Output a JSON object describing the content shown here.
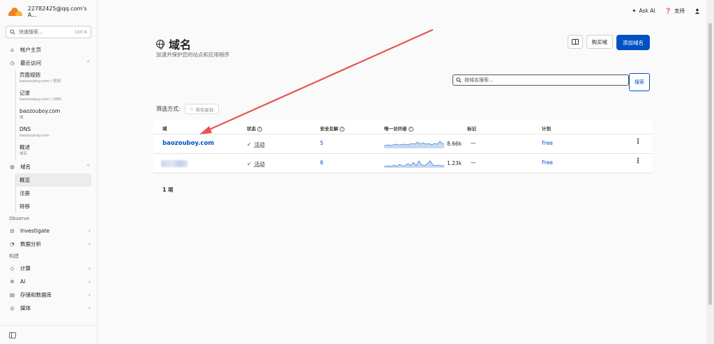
{
  "account": "22782425@qq.com's A...",
  "sidebar": {
    "search_placeholder": "快速搜索...",
    "search_shortcut": "Ctrl K",
    "home": "帐户主页",
    "recent": "最近访问",
    "recent_items": [
      {
        "title": "页面规则",
        "sub": "baozouboy.com / 规则"
      },
      {
        "title": "记录",
        "sub": "baozouboy.com / DNS"
      },
      {
        "title": "baozouboy.com",
        "sub": "域"
      },
      {
        "title": "DNS",
        "sub": "baozouboy.com"
      },
      {
        "title": "概述",
        "sub": "域名"
      }
    ],
    "domains": "域名",
    "domain_items": [
      "概览",
      "注册",
      "转移"
    ],
    "observe_head": "Observe",
    "investigate": "Investigate",
    "analytics": "数据分析",
    "build_head": "构建",
    "compute": "计算",
    "ai": "AI",
    "storage": "存储和数据库",
    "media": "媒体"
  },
  "topbar": {
    "ask_ai": "Ask AI",
    "support": "支持"
  },
  "page": {
    "title": "域名",
    "subtitle": "加速并保护您的站点和应用程序",
    "buy_domain": "购买域",
    "add_domain": "添加域名",
    "search_placeholder": "按域名搜索...",
    "search_button": "搜索",
    "filter_label": "筛选方式:",
    "starred_chip": "带有星标"
  },
  "table": {
    "headers": {
      "domain": "域",
      "status": "状态",
      "insights": "安全见解",
      "visitors": "唯一访问者",
      "tags": "标记",
      "plan": "计划"
    },
    "rows": [
      {
        "domain": "baozouboy.com",
        "status": "活动",
        "insights": "5",
        "visitors": "8.66k",
        "tags": "—",
        "plan": "Free"
      },
      {
        "domain": "",
        "status": "活动",
        "insights": "6",
        "visitors": "1.23k",
        "tags": "—",
        "plan": "Free"
      }
    ],
    "count": "1 项"
  },
  "colors": {
    "accent": "#0051c3",
    "brand_orange": "#f48120",
    "annotation_arrow": "#e8534f"
  }
}
